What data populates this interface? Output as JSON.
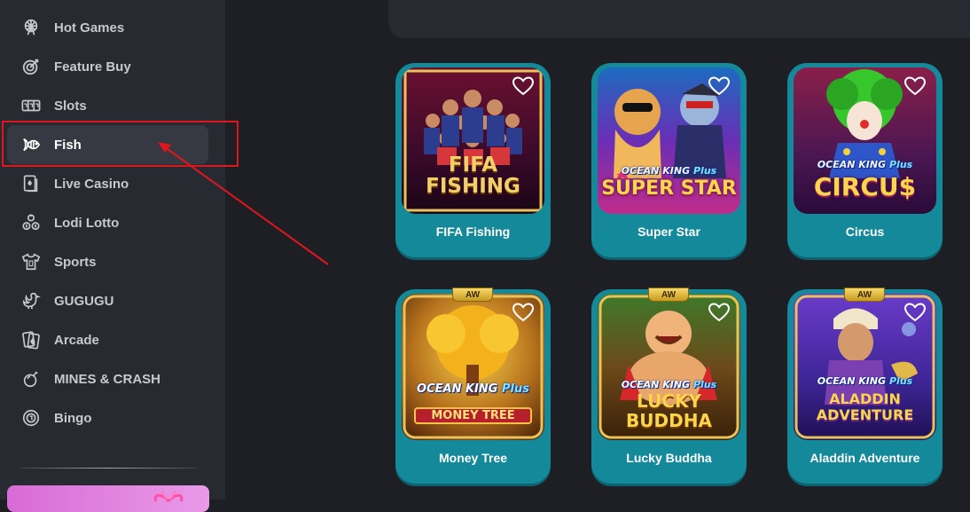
{
  "sidebar": {
    "items": [
      {
        "label": "Hot Games",
        "icon": "ferris-wheel-icon"
      },
      {
        "label": "Feature Buy",
        "icon": "target-icon"
      },
      {
        "label": "Slots",
        "icon": "slot-machine-icon"
      },
      {
        "label": "Fish",
        "icon": "fish-icon",
        "active": true
      },
      {
        "label": "Live Casino",
        "icon": "playing-card-icon"
      },
      {
        "label": "Lodi Lotto",
        "icon": "lottery-balls-icon"
      },
      {
        "label": "Sports",
        "icon": "jersey-icon"
      },
      {
        "label": "GUGUGU",
        "icon": "rooster-icon"
      },
      {
        "label": "Arcade",
        "icon": "cards-icon"
      },
      {
        "label": "MINES & CRASH",
        "icon": "bomb-icon"
      },
      {
        "label": "Bingo",
        "icon": "bingo-ball-icon"
      }
    ]
  },
  "annotation": {
    "color": "#e0161d",
    "target": "Fish"
  },
  "games": [
    {
      "title": "FIFA Fishing",
      "art_text": "FIFA\nFISHING",
      "badge": ""
    },
    {
      "title": "Super Star",
      "brand": "OCEAN KING",
      "brand_plus": "Plus",
      "art_text": "SUPER STAR",
      "badge": ""
    },
    {
      "title": "Circus",
      "brand": "OCEAN KING",
      "brand_plus": "Plus",
      "art_text": "CIRCU$",
      "badge": ""
    },
    {
      "title": "Money Tree",
      "brand": "OCEAN KING",
      "brand_plus": "Plus",
      "art_text": "MONEY TREE",
      "badge": "AW"
    },
    {
      "title": "Lucky Buddha",
      "brand": "OCEAN KING",
      "brand_plus": "Plus",
      "art_text": "LUCKY BUDDHA",
      "badge": "AW"
    },
    {
      "title": "Aladdin Adventure",
      "brand": "OCEAN KING",
      "brand_plus": "Plus",
      "art_text": "ALADDIN ADVENTURE",
      "badge": "AW"
    }
  ],
  "colors": {
    "card": "#13899a",
    "sidebar": "#272a31",
    "background": "#1d1f24"
  }
}
